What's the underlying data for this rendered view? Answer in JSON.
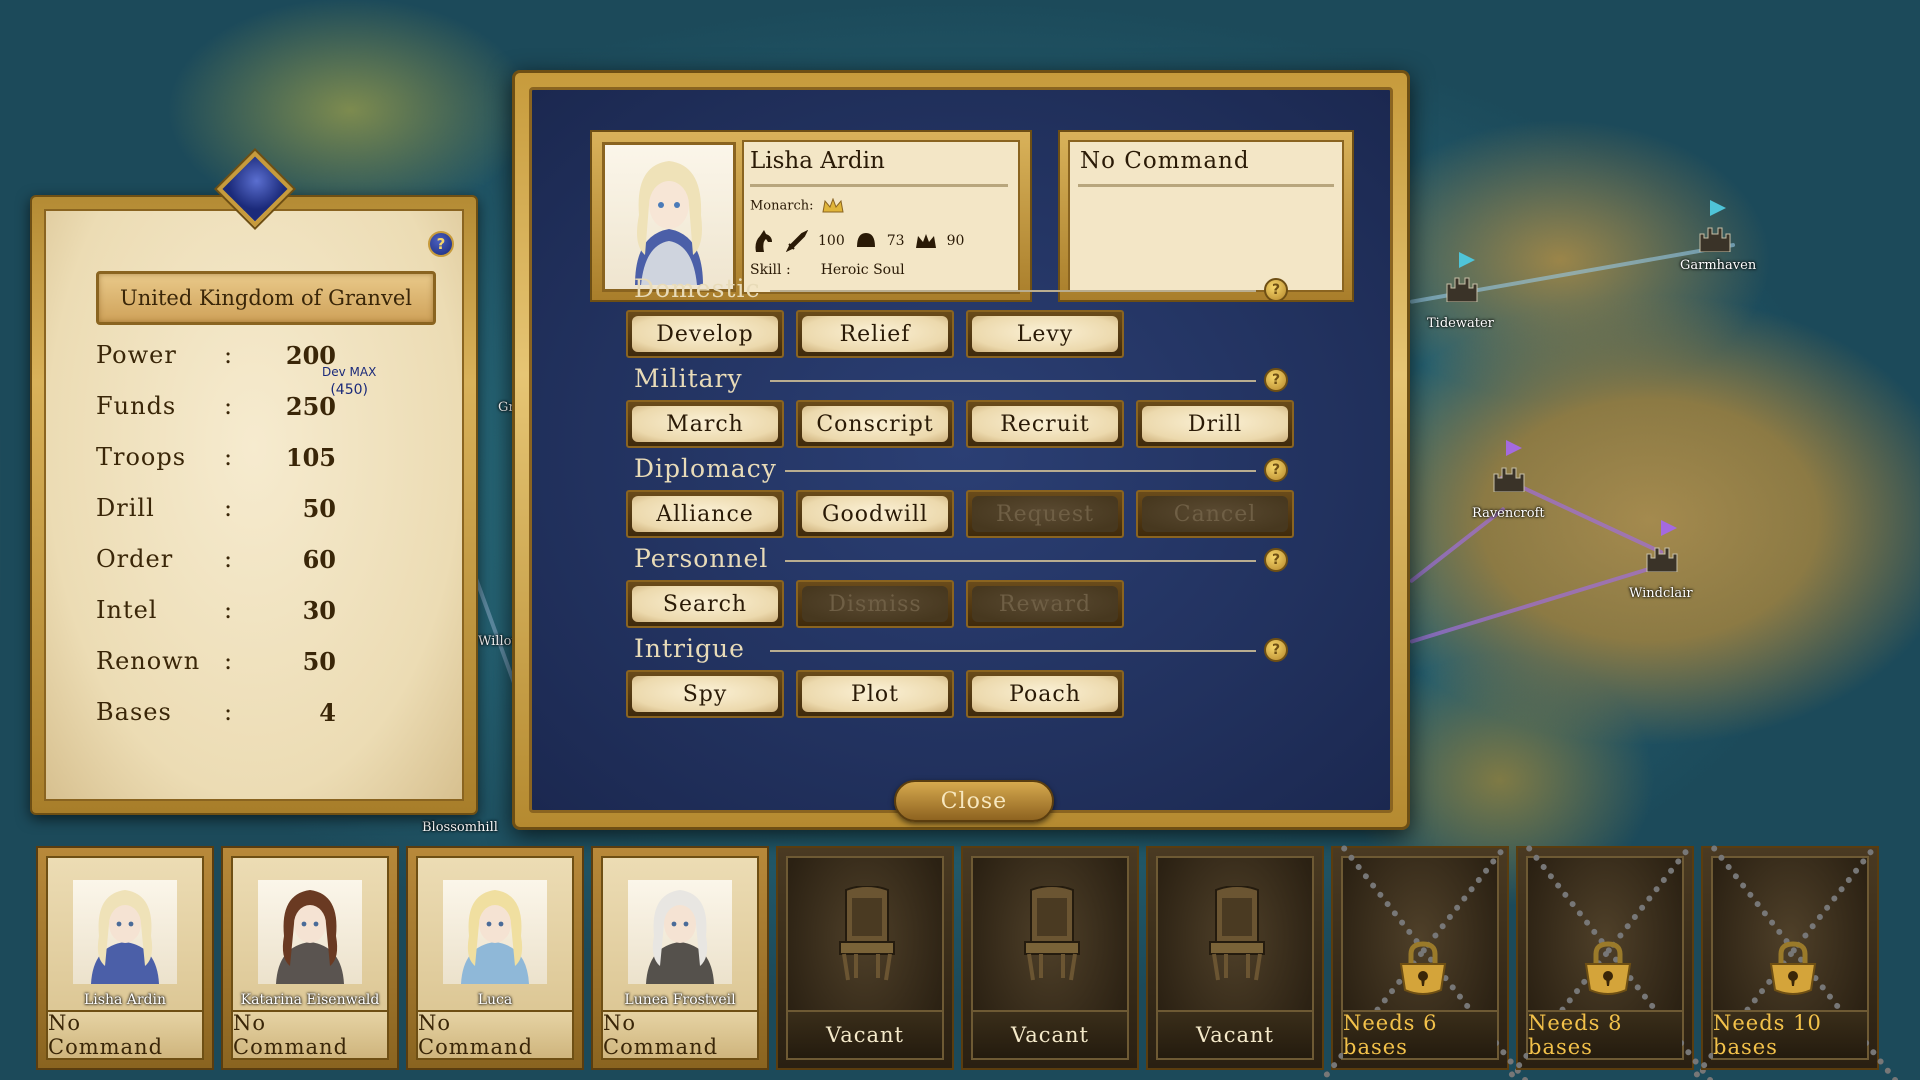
{
  "map": {
    "locations": [
      {
        "name": "Garmhaven"
      },
      {
        "name": "Tidewater"
      },
      {
        "name": "Ravencroft"
      },
      {
        "name": "Windclair"
      },
      {
        "name": "Blossomhill"
      },
      {
        "name": "Willow"
      },
      {
        "name": "Gr"
      }
    ]
  },
  "kingdom": {
    "name": "United Kingdom of Granvel",
    "help_icon": "?",
    "stats": [
      {
        "label": "Power",
        "value": "200"
      },
      {
        "label": "Funds",
        "value": "250"
      },
      {
        "label": "Troops",
        "value": "105"
      },
      {
        "label": "Drill",
        "value": "50"
      },
      {
        "label": "Order",
        "value": "60"
      },
      {
        "label": "Intel",
        "value": "30"
      },
      {
        "label": "Renown",
        "value": "50"
      },
      {
        "label": "Bases",
        "value": "4"
      }
    ],
    "separator": ":",
    "dev_max_label": "Dev MAX",
    "dev_max_value": "(450)"
  },
  "officer": {
    "name": "Lisha Ardin",
    "role_label": "Monarch:",
    "stat_1": "100",
    "stat_2": "73",
    "stat_3": "90",
    "skill_label": "Skill :",
    "skill_value": "Heroic Soul",
    "command": "No Command"
  },
  "sections": [
    {
      "title": "Domestic",
      "buttons": [
        {
          "label": "Develop",
          "enabled": true
        },
        {
          "label": "Relief",
          "enabled": true
        },
        {
          "label": "Levy",
          "enabled": true
        }
      ]
    },
    {
      "title": "Military",
      "buttons": [
        {
          "label": "March",
          "enabled": true
        },
        {
          "label": "Conscript",
          "enabled": true
        },
        {
          "label": "Recruit",
          "enabled": true
        },
        {
          "label": "Drill",
          "enabled": true
        }
      ]
    },
    {
      "title": "Diplomacy",
      "buttons": [
        {
          "label": "Alliance",
          "enabled": true
        },
        {
          "label": "Goodwill",
          "enabled": true
        },
        {
          "label": "Request",
          "enabled": false
        },
        {
          "label": "Cancel",
          "enabled": false
        }
      ]
    },
    {
      "title": "Personnel",
      "buttons": [
        {
          "label": "Search",
          "enabled": true
        },
        {
          "label": "Dismiss",
          "enabled": false
        },
        {
          "label": "Reward",
          "enabled": false
        }
      ]
    },
    {
      "title": "Intrigue",
      "buttons": [
        {
          "label": "Spy",
          "enabled": true
        },
        {
          "label": "Plot",
          "enabled": true
        },
        {
          "label": "Poach",
          "enabled": true
        }
      ]
    }
  ],
  "help_glyph": "?",
  "close_label": "Close",
  "slots": [
    {
      "type": "officer",
      "name": "Lisha Ardin",
      "command": "No Command",
      "hair": "#efe2b8",
      "armor": "#4b5fa8"
    },
    {
      "type": "officer",
      "name": "Katarina Eisenwald",
      "command": "No Command",
      "hair": "#6a3a22",
      "armor": "#5a5450"
    },
    {
      "type": "officer",
      "name": "Luca",
      "command": "No Command",
      "hair": "#f0dfa0",
      "armor": "#8fb8d8"
    },
    {
      "type": "officer",
      "name": "Lunea Frostveil",
      "command": "No Command",
      "hair": "#e8e6e2",
      "armor": "#55514c"
    },
    {
      "type": "vacant",
      "command": "Vacant"
    },
    {
      "type": "vacant",
      "command": "Vacant"
    },
    {
      "type": "vacant",
      "command": "Vacant"
    },
    {
      "type": "locked",
      "command": "Needs 6 bases"
    },
    {
      "type": "locked",
      "command": "Needs 8 bases"
    },
    {
      "type": "locked",
      "command": "Needs 10 bases"
    }
  ],
  "icons": {
    "crown": "crown-icon",
    "horse": "horse-icon",
    "sword": "sword-icon",
    "helm": "helm-icon",
    "throne": "throne-icon",
    "lock": "padlock-icon",
    "chain": "chain-icon"
  },
  "colors": {
    "dialog_bg": "#22325f",
    "gold": "#c79b3c",
    "parchment": "#f3e6c6",
    "disabled": "#47381f",
    "lock_text": "#f2c14a"
  }
}
